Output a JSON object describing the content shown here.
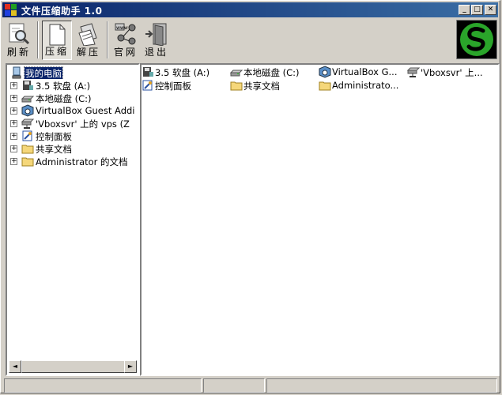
{
  "window": {
    "title": "文件压缩助手 1.0",
    "controls": {
      "minimize": "_",
      "maximize": "□",
      "close": "✕"
    }
  },
  "toolbar": {
    "refresh": "刷新",
    "compress": "压缩",
    "extract": "解压",
    "website": "官网",
    "exit": "退出"
  },
  "tree": {
    "root": "我的电脑",
    "items": [
      "3.5 软盘 (A:)",
      "本地磁盘 (C:)",
      "VirtualBox Guest Addi",
      "'Vboxsvr' 上的 vps (Z",
      "控制面板",
      "共享文档",
      "Administrator 的文档"
    ]
  },
  "list": {
    "items": [
      "3.5 软盘 (A:)",
      "本地磁盘 (C:)",
      "VirtualBox G...",
      "'Vboxsvr' 上...",
      "控制面板",
      "共享文档",
      "Administrato..."
    ]
  },
  "scrollbar": {
    "left": "◄",
    "right": "►"
  }
}
